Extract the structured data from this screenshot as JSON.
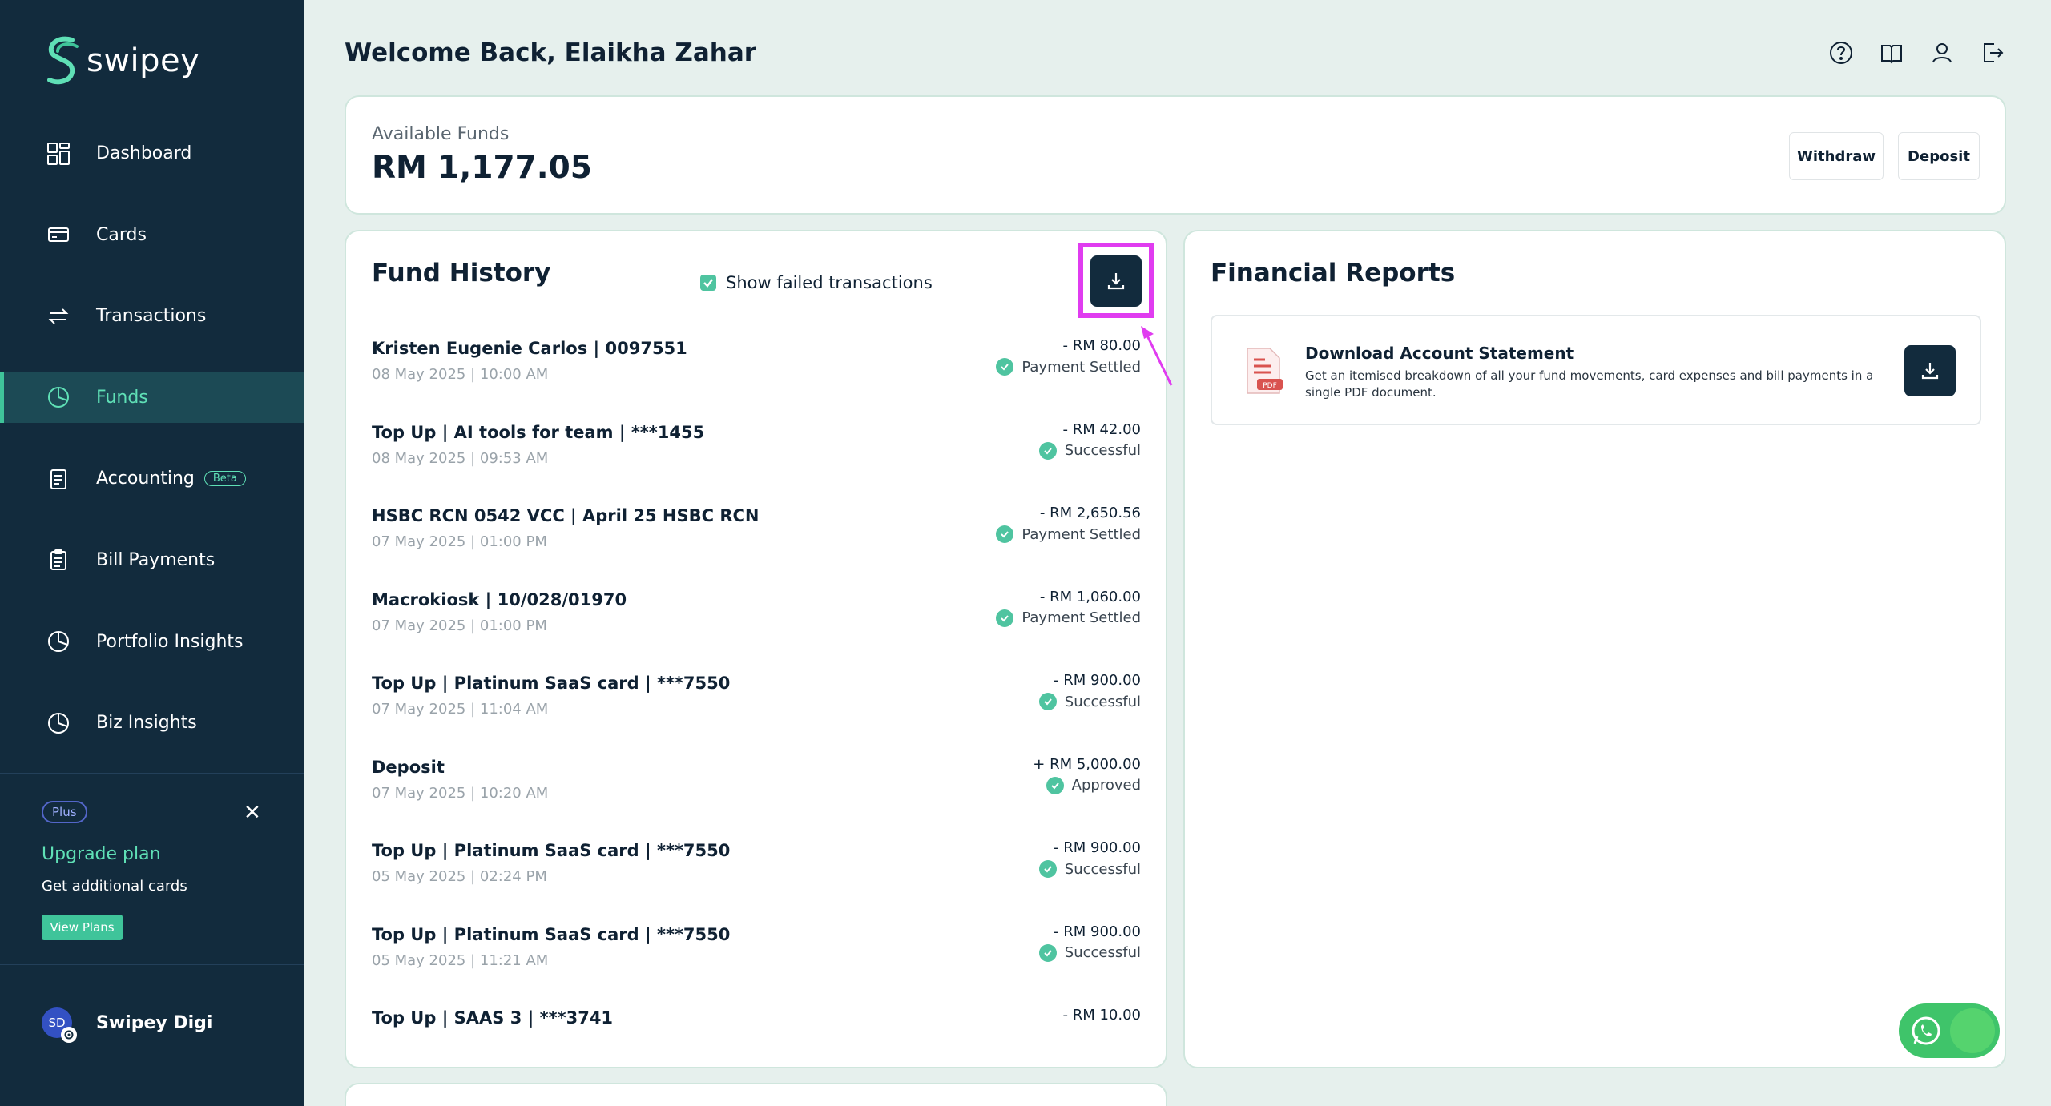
{
  "app": {
    "name": "swipey"
  },
  "sidebar": {
    "items": [
      {
        "label": "Dashboard",
        "icon": "dashboard-icon"
      },
      {
        "label": "Cards",
        "icon": "card-icon"
      },
      {
        "label": "Transactions",
        "icon": "transfer-icon"
      },
      {
        "label": "Funds",
        "icon": "pie-chart-icon",
        "active": true
      },
      {
        "label": "Accounting",
        "icon": "ledger-icon",
        "badge": "Beta"
      },
      {
        "label": "Bill Payments",
        "icon": "clipboard-icon"
      },
      {
        "label": "Portfolio Insights",
        "icon": "pie-chart-icon"
      },
      {
        "label": "Biz Insights",
        "icon": "pie-chart-icon"
      }
    ],
    "promo": {
      "badge": "Plus",
      "title": "Upgrade plan",
      "subtitle": "Get additional cards",
      "button": "View Plans"
    },
    "user": {
      "initials": "SD",
      "name": "Swipey Digi"
    }
  },
  "header": {
    "welcome": "Welcome Back, Elaikha Zahar"
  },
  "funds": {
    "label": "Available Funds",
    "amount": "RM 1,177.05",
    "withdraw": "Withdraw",
    "deposit": "Deposit"
  },
  "history": {
    "title": "Fund History",
    "show_failed_label": "Show failed transactions",
    "show_failed_checked": true,
    "transactions": [
      {
        "name": "Kristen Eugenie Carlos | 0097551",
        "date": "08 May 2025 | 10:00 AM",
        "amount": "- RM 80.00",
        "status": "Payment Settled"
      },
      {
        "name": "Top Up | AI tools for team | ***1455",
        "date": "08 May 2025 | 09:53 AM",
        "amount": "- RM 42.00",
        "status": "Successful"
      },
      {
        "name": "HSBC RCN 0542 VCC | April 25 HSBC RCN",
        "date": "07 May 2025 | 01:00 PM",
        "amount": "- RM 2,650.56",
        "status": "Payment Settled"
      },
      {
        "name": "Macrokiosk | 10/028/01970",
        "date": "07 May 2025 | 01:00 PM",
        "amount": "- RM 1,060.00",
        "status": "Payment Settled"
      },
      {
        "name": "Top Up | Platinum SaaS card | ***7550",
        "date": "07 May 2025 | 11:04 AM",
        "amount": "- RM 900.00",
        "status": "Successful"
      },
      {
        "name": "Deposit",
        "date": "07 May 2025 | 10:20 AM",
        "amount": "+ RM 5,000.00",
        "status": "Approved"
      },
      {
        "name": "Top Up | Platinum SaaS card | ***7550",
        "date": "05 May 2025 | 02:24 PM",
        "amount": "- RM 900.00",
        "status": "Successful"
      },
      {
        "name": "Top Up | Platinum SaaS card | ***7550",
        "date": "05 May 2025 | 11:21 AM",
        "amount": "- RM 900.00",
        "status": "Successful"
      },
      {
        "name": "Top Up | SAAS 3 | ***3741",
        "date": "",
        "amount": "- RM 10.00",
        "status": ""
      }
    ]
  },
  "reports": {
    "title": "Financial Reports",
    "statement_title": "Download Account Statement",
    "statement_desc": "Get an itemised breakdown of all your fund movements, card expenses and bill payments in a single PDF document.",
    "pdf_label": "PDF"
  },
  "colors": {
    "sidebar": "#122b3d",
    "accent": "#3fc49a",
    "highlight": "#e03cf0",
    "background": "#e6f0ed"
  }
}
